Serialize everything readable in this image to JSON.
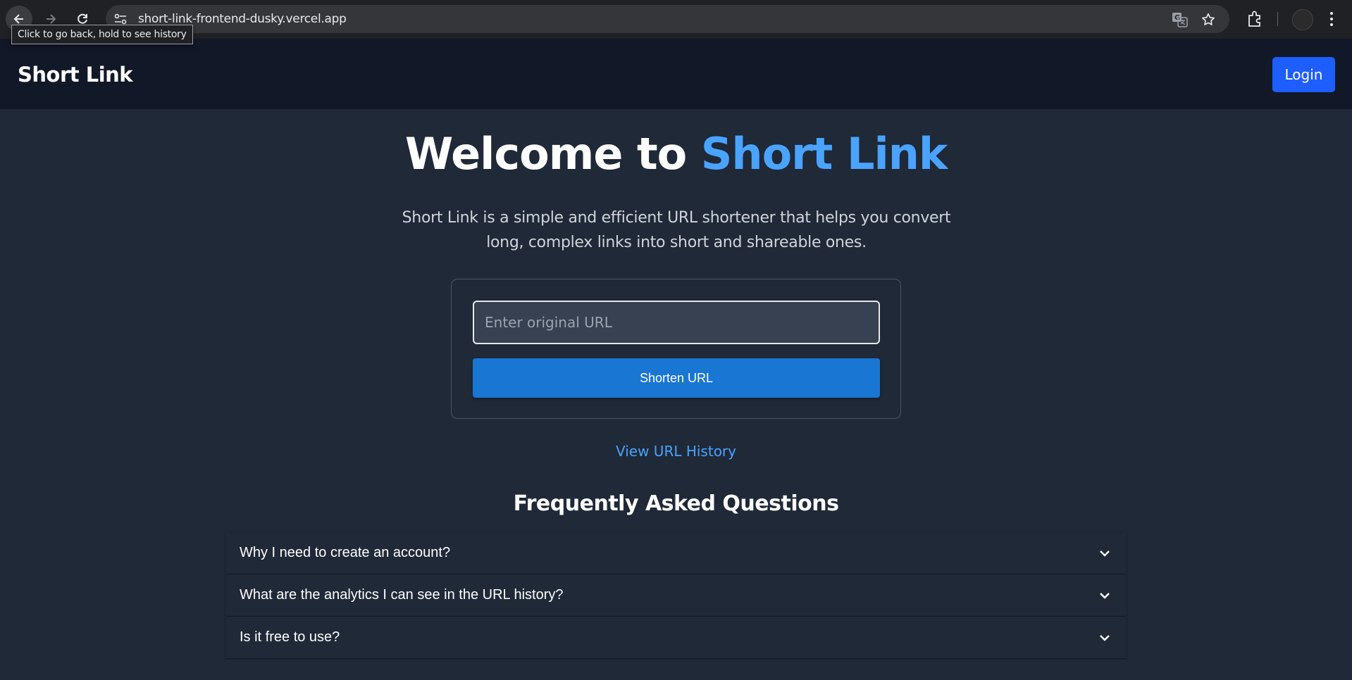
{
  "browser": {
    "url": "short-link-frontend-dusky.vercel.app",
    "tooltip": "Click to go back, hold to see history",
    "icons": [
      "back-arrow-icon",
      "forward-arrow-icon",
      "reload-icon",
      "site-settings-icon",
      "translate-icon",
      "bookmark-star-icon",
      "extensions-icon",
      "profile-avatar",
      "more-menu-icon"
    ]
  },
  "header": {
    "brand": "Short Link",
    "login_label": "Login",
    "login_color": "#1e5eff",
    "background": "#111827"
  },
  "hero": {
    "title_prefix": "Welcome to ",
    "title_accent": "Short Link",
    "accent_color": "#4aa3ff",
    "subtitle": "Short Link is a simple and efficient URL shortener that helps you convert long, complex links into short and shareable ones."
  },
  "form": {
    "input_placeholder": "Enter original URL",
    "input_value": "",
    "submit_label": "Shorten URL",
    "submit_color": "#1976d2"
  },
  "history_link": "View URL History",
  "faq": {
    "title": "Frequently Asked Questions",
    "items": [
      {
        "question": "Why I need to create an account?",
        "icon": "chevron-down-icon"
      },
      {
        "question": "What are the analytics I can see in the URL history?",
        "icon": "chevron-down-icon"
      },
      {
        "question": "Is it free to use?",
        "icon": "chevron-down-icon"
      }
    ]
  }
}
